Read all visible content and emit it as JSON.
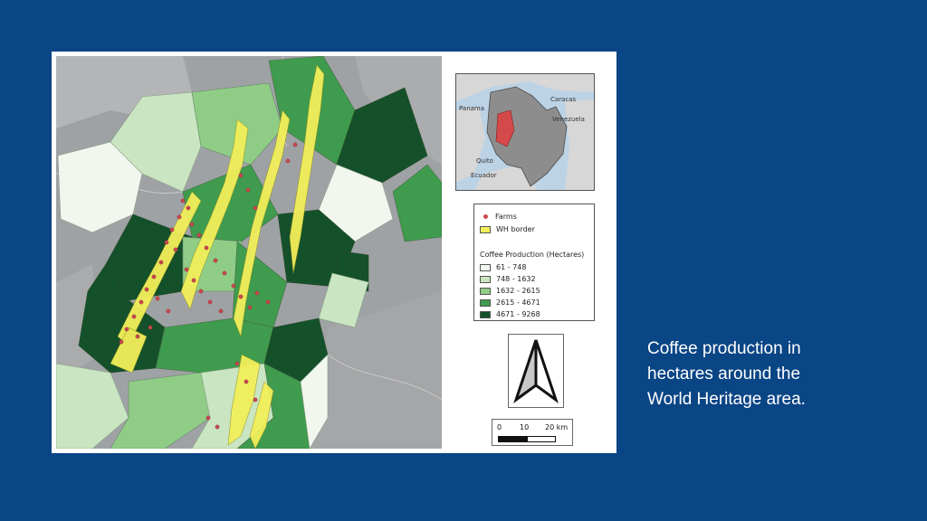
{
  "caption": {
    "line1": "Coffee production in",
    "line2": "hectares around the",
    "line3": "World Heritage area."
  },
  "legend": {
    "farms_label": "Farms",
    "wh_border_label": "WH border",
    "production_title": "Coffee Production (Hectares)",
    "classes": [
      {
        "label": "61 - 748",
        "color": "#f1f7ee"
      },
      {
        "label": "748 - 1632",
        "color": "#c9e5c1"
      },
      {
        "label": "1632 - 2615",
        "color": "#8fcd87"
      },
      {
        "label": "2615 - 4671",
        "color": "#3f9b4d"
      },
      {
        "label": "4671 - 9268",
        "color": "#14512a"
      }
    ],
    "farm_color": "#c8484f",
    "wh_color": "#f2ef5a"
  },
  "inset": {
    "labels": [
      "Caracas",
      "Panama",
      "Venezuela",
      "Quito",
      "Ecuador"
    ]
  },
  "scale": {
    "ticks": [
      "0",
      "10",
      "20 km"
    ]
  },
  "colors": {
    "background": "#0a4585",
    "caption_text": "#ffffff"
  }
}
